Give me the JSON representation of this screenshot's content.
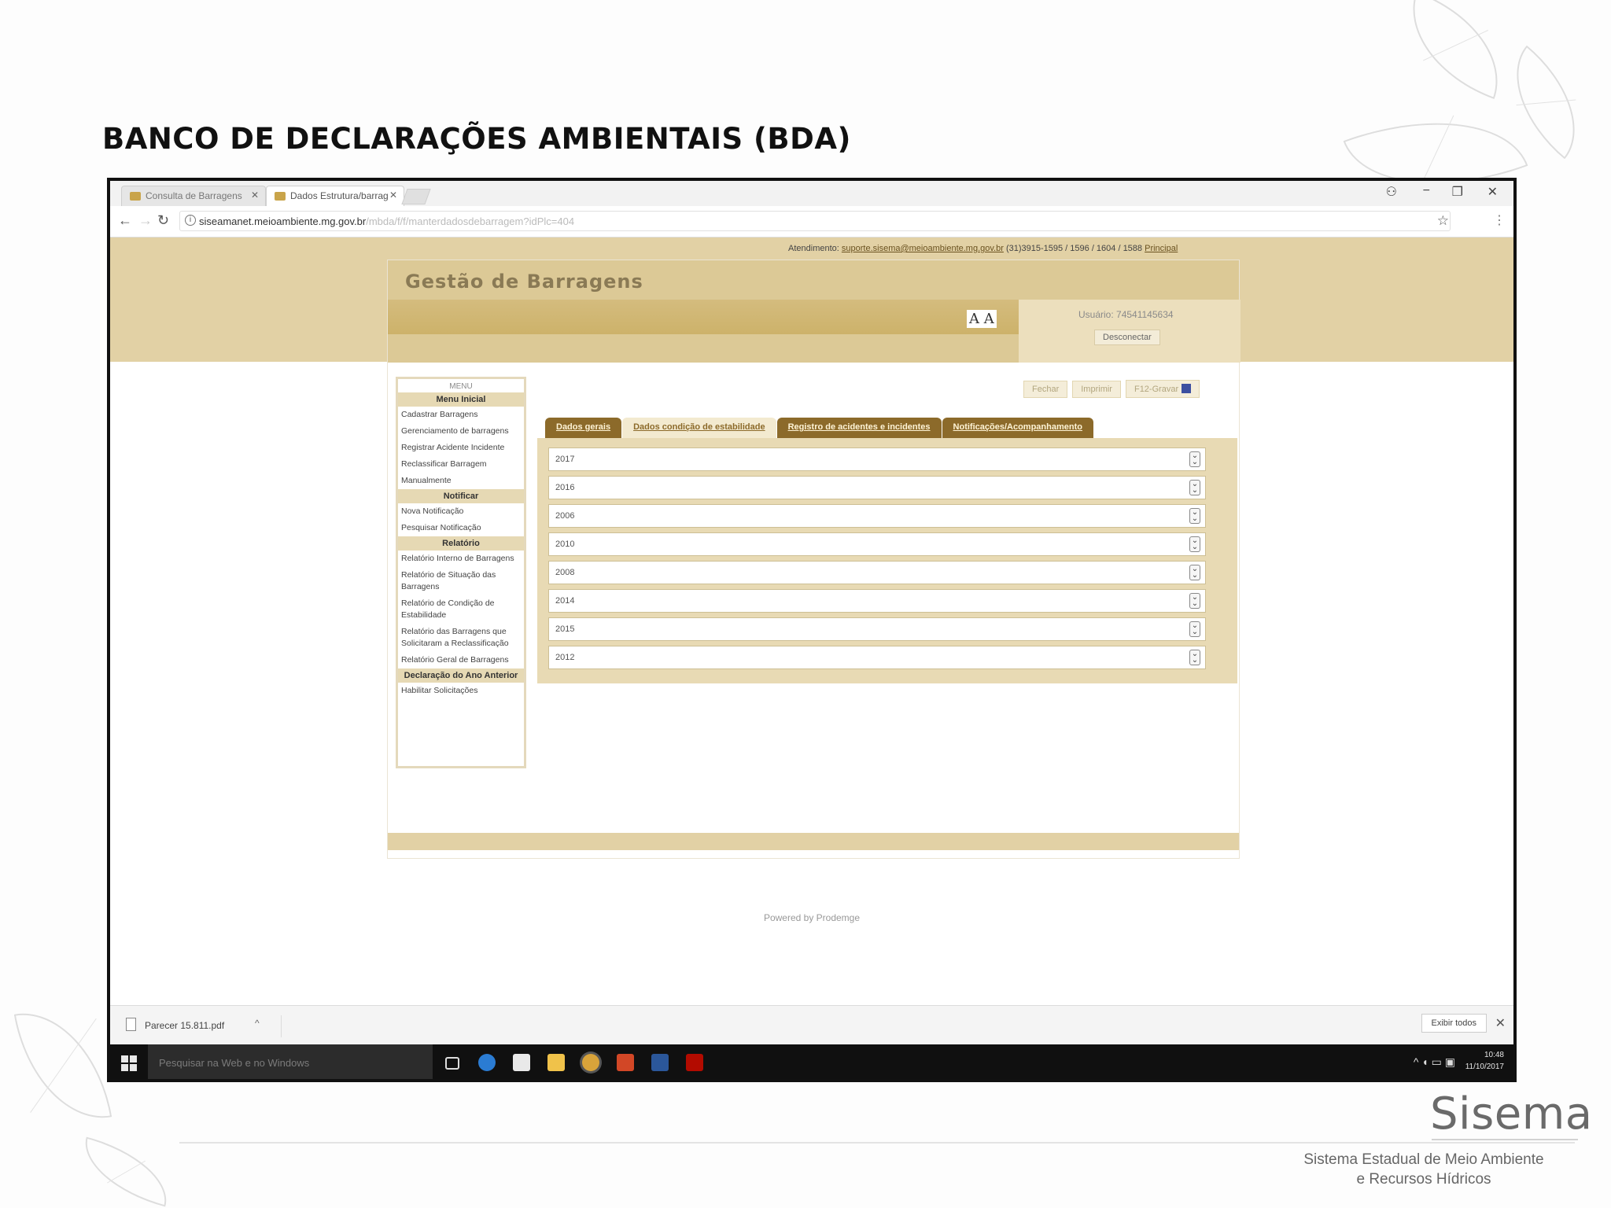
{
  "slide": {
    "title": "BANCO DE DECLARAÇÕES AMBIENTAIS (BDA)",
    "logo": "Sisema",
    "logo_sub_1": "Sistema Estadual de Meio Ambiente",
    "logo_sub_2": "e Recursos Hídricos"
  },
  "browser": {
    "tabs": [
      {
        "label": "Consulta de Barragens",
        "active": false
      },
      {
        "label": "Dados Estrutura/barrag",
        "active": true
      }
    ],
    "url_host": "siseamanet.meioambiente.mg.gov.br",
    "url_path": "/mbda/f/f/manterdadosdebarragem?idPlc=404"
  },
  "page": {
    "atendimento_label": "Atendimento:",
    "atendimento_email": "suporte.sisema@meioambiente.mg.gov.br",
    "atendimento_phones": "(31)3915-1595 / 1596 / 1604 / 1588",
    "atendimento_link": "Principal",
    "app_title": "Gestão de Barragens",
    "font_buttons": "A A",
    "usuario": "Usuário: 74541145634",
    "disconnect_label": "Desconectar",
    "toolbar": {
      "fechar": "Fechar",
      "imprimir": "Imprimir",
      "gravar": "F12-Gravar"
    },
    "menu": {
      "caption": "MENU",
      "sections": [
        {
          "title": "Menu Inicial",
          "items": [
            "Cadastrar Barragens",
            "Gerenciamento de barragens",
            "Registrar Acidente Incidente",
            "Reclassificar Barragem",
            "Manualmente"
          ]
        },
        {
          "title": "Notificar",
          "items": [
            "Nova Notificação",
            "Pesquisar Notificação"
          ]
        },
        {
          "title": "Relatório",
          "items": [
            "Relatório Interno de Barragens",
            "Relatório de Situação das Barragens",
            "Relatório de Condição de Estabilidade",
            "Relatório das Barragens que Solicitaram a Reclassificação",
            "Relatório Geral de Barragens"
          ]
        },
        {
          "title": "Declaração do Ano Anterior",
          "items": [
            "Habilitar Solicitações"
          ]
        }
      ]
    },
    "content_tabs": [
      {
        "label": "Dados gerais",
        "active": false
      },
      {
        "label": "Dados condição de estabilidade",
        "active": true
      },
      {
        "label": "Registro de acidentes e incidentes",
        "active": false
      },
      {
        "label": "Notificações/Acompanhamento",
        "active": false
      }
    ],
    "years": [
      "2017",
      "2016",
      "2006",
      "2010",
      "2008",
      "2014",
      "2015",
      "2012"
    ],
    "powered_by": "Powered by Prodemge"
  },
  "downloads": {
    "file": "Parecer 15.811.pdf",
    "show_all": "Exibir todos"
  },
  "taskbar": {
    "search_placeholder": "Pesquisar na Web e no Windows",
    "time": "10:48",
    "date": "11/10/2017"
  },
  "colors": {
    "band": "#e2d1a5",
    "tab_dark": "#8c6a2a",
    "panel": "#e8dab4"
  }
}
